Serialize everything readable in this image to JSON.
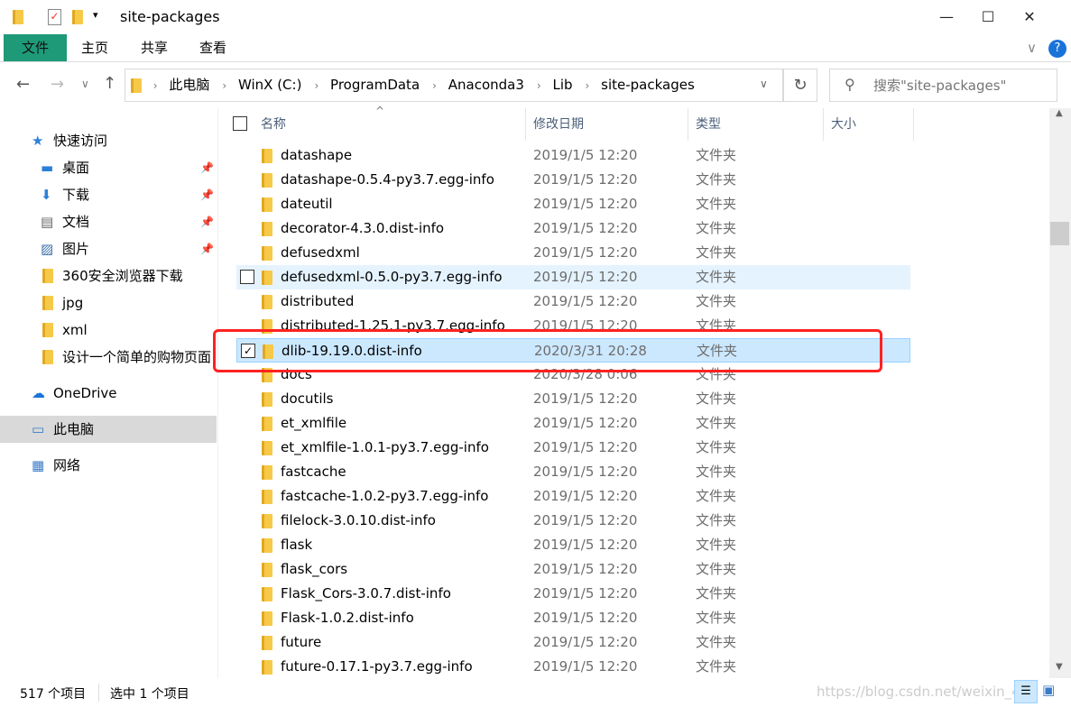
{
  "window": {
    "title": "site-packages",
    "minimize": "—",
    "maximize": "☐",
    "close": "✕"
  },
  "ribbon": {
    "tabs": [
      "文件",
      "主页",
      "共享",
      "查看"
    ],
    "help": "?",
    "collapse": "∨"
  },
  "nav": {
    "back": "←",
    "forward": "→",
    "recent": "∨",
    "up": "↑",
    "refresh": "↻",
    "dropdown": "∨"
  },
  "address": {
    "crumbs": [
      "此电脑",
      "WinX (C:)",
      "ProgramData",
      "Anaconda3",
      "Lib",
      "site-packages"
    ]
  },
  "search": {
    "placeholder": "搜索\"site-packages\""
  },
  "sidebar": {
    "items": [
      {
        "label": "快速访问",
        "icon": "star-icon",
        "pinned": false
      },
      {
        "label": "桌面",
        "icon": "desktop-icon",
        "pinned": true
      },
      {
        "label": "下载",
        "icon": "download-icon",
        "pinned": true
      },
      {
        "label": "文档",
        "icon": "document-icon",
        "pinned": true
      },
      {
        "label": "图片",
        "icon": "picture-icon",
        "pinned": true
      },
      {
        "label": "360安全浏览器下载",
        "icon": "folder-icon",
        "pinned": false
      },
      {
        "label": "jpg",
        "icon": "folder-icon",
        "pinned": false
      },
      {
        "label": "xml",
        "icon": "folder-icon",
        "pinned": false
      },
      {
        "label": "设计一个简单的购物页面",
        "icon": "folder-icon",
        "pinned": false
      },
      {
        "label": "OneDrive",
        "icon": "cloud-icon",
        "pinned": false
      },
      {
        "label": "此电脑",
        "icon": "computer-icon",
        "pinned": false,
        "selected": true
      },
      {
        "label": "网络",
        "icon": "network-icon",
        "pinned": false
      }
    ]
  },
  "columns": [
    "名称",
    "修改日期",
    "类型",
    "大小"
  ],
  "files": [
    {
      "name": "datashape",
      "date": "2019/1/5 12:20",
      "type": "文件夹"
    },
    {
      "name": "datashape-0.5.4-py3.7.egg-info",
      "date": "2019/1/5 12:20",
      "type": "文件夹"
    },
    {
      "name": "dateutil",
      "date": "2019/1/5 12:20",
      "type": "文件夹"
    },
    {
      "name": "decorator-4.3.0.dist-info",
      "date": "2019/1/5 12:20",
      "type": "文件夹"
    },
    {
      "name": "defusedxml",
      "date": "2019/1/5 12:20",
      "type": "文件夹"
    },
    {
      "name": "defusedxml-0.5.0-py3.7.egg-info",
      "date": "2019/1/5 12:20",
      "type": "文件夹",
      "state": "hover"
    },
    {
      "name": "distributed",
      "date": "2019/1/5 12:20",
      "type": "文件夹"
    },
    {
      "name": "distributed-1.25.1-py3.7.egg-info",
      "date": "2019/1/5 12:20",
      "type": "文件夹"
    },
    {
      "name": "dlib-19.19.0.dist-info",
      "date": "2020/3/31 20:28",
      "type": "文件夹",
      "state": "selected"
    },
    {
      "name": "docs",
      "date": "2020/3/28 0:06",
      "type": "文件夹"
    },
    {
      "name": "docutils",
      "date": "2019/1/5 12:20",
      "type": "文件夹"
    },
    {
      "name": "et_xmlfile",
      "date": "2019/1/5 12:20",
      "type": "文件夹"
    },
    {
      "name": "et_xmlfile-1.0.1-py3.7.egg-info",
      "date": "2019/1/5 12:20",
      "type": "文件夹"
    },
    {
      "name": "fastcache",
      "date": "2019/1/5 12:20",
      "type": "文件夹"
    },
    {
      "name": "fastcache-1.0.2-py3.7.egg-info",
      "date": "2019/1/5 12:20",
      "type": "文件夹"
    },
    {
      "name": "filelock-3.0.10.dist-info",
      "date": "2019/1/5 12:20",
      "type": "文件夹"
    },
    {
      "name": "flask",
      "date": "2019/1/5 12:20",
      "type": "文件夹"
    },
    {
      "name": "flask_cors",
      "date": "2019/1/5 12:20",
      "type": "文件夹"
    },
    {
      "name": "Flask_Cors-3.0.7.dist-info",
      "date": "2019/1/5 12:20",
      "type": "文件夹"
    },
    {
      "name": "Flask-1.0.2.dist-info",
      "date": "2019/1/5 12:20",
      "type": "文件夹"
    },
    {
      "name": "future",
      "date": "2019/1/5 12:20",
      "type": "文件夹"
    },
    {
      "name": "future-0.17.1-py3.7.egg-info",
      "date": "2019/1/5 12:20",
      "type": "文件夹"
    }
  ],
  "status": {
    "count": "517 个项目",
    "selected": "选中 1 个项目"
  },
  "watermark": "https://blog.csdn.net/weixin_42",
  "colors": {
    "file_tab": "#1e9a78",
    "selection": "#cce8ff",
    "hover": "#e5f3ff",
    "highlight_box": "#ff2222"
  }
}
